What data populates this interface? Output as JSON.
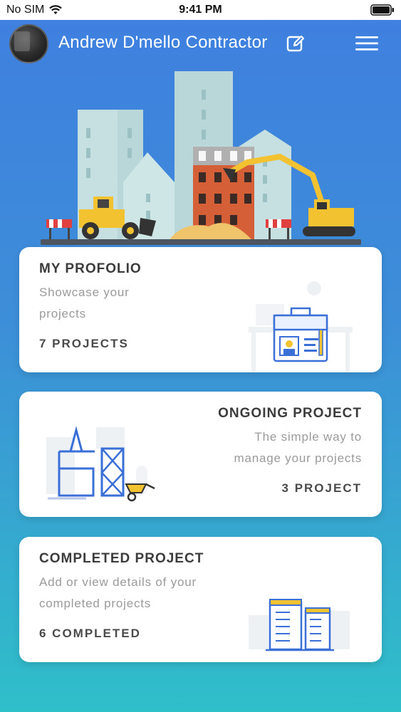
{
  "status_bar": {
    "carrier": "No SIM",
    "time": "9:41 PM"
  },
  "header": {
    "title": "Andrew D'mello Contractor"
  },
  "cards": [
    {
      "title": "MY PROFOLIO",
      "description": "Showcase your projects",
      "desc_line1": "Showcase your",
      "desc_line2": "projects",
      "count": "7 PROJECTS"
    },
    {
      "title": "ONGOING PROJECT",
      "description": "The simple way to manage your projects",
      "desc_line1": "The simple way to",
      "desc_line2": "manage your projects",
      "count": "3 PROJECT"
    },
    {
      "title": "COMPLETED PROJECT",
      "description": "Add or view details of your completed projects",
      "desc_line1": "Add or view details of your",
      "desc_line2": "completed projects",
      "count": "6 COMPLETED"
    }
  ],
  "colors": {
    "accent": "#3f7fe0",
    "gradient_bottom": "#2fbfc9",
    "illustration_blue": "#3a6fd8",
    "illustration_yellow": "#f2c230"
  }
}
